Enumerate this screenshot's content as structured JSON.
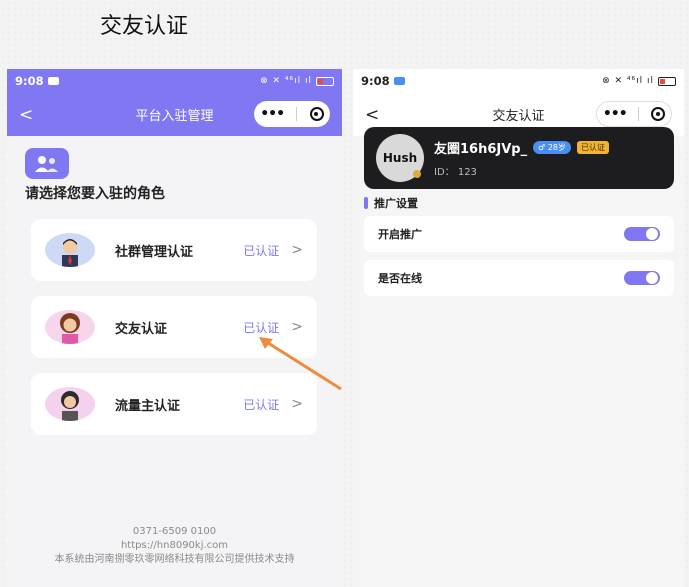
{
  "heading": "交友认证",
  "left_phone": {
    "status": {
      "time": "9:08",
      "icons": "⊗ ✕ ⁴⁶ıl ıl"
    },
    "nav": {
      "back": "<",
      "title": "平台入驻管理",
      "dots": "•••"
    },
    "prompt": "请选择您要入驻的角色",
    "roles": [
      {
        "name": "社群管理认证",
        "status": "已认证",
        "chevron": ">"
      },
      {
        "name": "交友认证",
        "status": "已认证",
        "chevron": ">"
      },
      {
        "name": "流量主认证",
        "status": "已认证",
        "chevron": ">"
      }
    ],
    "footer": {
      "phone": "0371-6509 0100",
      "url": "https://hn8090kj.com",
      "company": "本系统由河南捌零玖零网络科技有限公司提供技术支持"
    }
  },
  "right_phone": {
    "status": {
      "time": "9:08",
      "icons": "⊗ ✕ ⁴⁶ıl ıl"
    },
    "nav": {
      "back": "<",
      "title": "交友认证",
      "dots": "•••"
    },
    "profile": {
      "avatar_text": "Hush",
      "name": "友圈16h6JVp_",
      "age": "♂ 28岁",
      "verified": "已认证",
      "id": "ID： 123"
    },
    "section_title": "推广设置",
    "settings": [
      {
        "label": "开启推广",
        "on": true
      },
      {
        "label": "是否在线",
        "on": true
      }
    ]
  },
  "colors": {
    "accent": "#7f78f2",
    "arrow": "#f08a3c"
  }
}
